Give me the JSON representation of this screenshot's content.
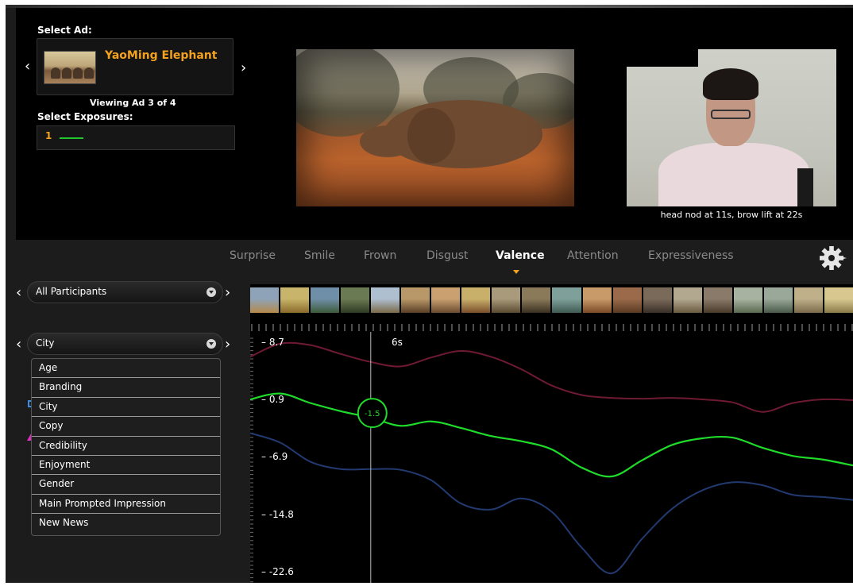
{
  "ad_selector": {
    "label": "Select Ad:",
    "ad_title": "YaoMing Elephant",
    "viewing_text": "Viewing Ad 3 of 4"
  },
  "exposures": {
    "label": "Select Exposures:",
    "items": [
      {
        "number": "1",
        "color": "#1fc82d"
      }
    ]
  },
  "camera": {
    "caption": "head nod at 11s, brow lift at 22s"
  },
  "tabs": [
    {
      "label": "Surprise",
      "active": false
    },
    {
      "label": "Smile",
      "active": false
    },
    {
      "label": "Frown",
      "active": false
    },
    {
      "label": "Disgust",
      "active": false
    },
    {
      "label": "Valence",
      "active": true
    },
    {
      "label": "Attention",
      "active": false
    },
    {
      "label": "Expressiveness",
      "active": false
    }
  ],
  "filters": {
    "participants_value": "All Participants",
    "segment_value": "City",
    "dropdown_options": [
      "Age",
      "Branding",
      "City",
      "Copy",
      "Credibility",
      "Enjoyment",
      "Gender",
      "Main Prompted Impression",
      "New News"
    ]
  },
  "icons": {
    "prev": "chevron-left-icon",
    "next": "chevron-right-icon",
    "settings": "gear-icon"
  },
  "colors": {
    "accent": "#f4a21e",
    "background": "#1c1c1c",
    "panel": "#000000"
  },
  "chart_data": {
    "type": "line",
    "xlabel": "",
    "ylabel": "",
    "cursor": {
      "time_label": "6s",
      "value_label": "-1.5"
    },
    "yticks": [
      8.7,
      0.9,
      -6.9,
      -14.8,
      -22.6
    ],
    "ylim": [
      -24.0,
      10.2
    ],
    "x_range": [
      0,
      30
    ],
    "series": [
      {
        "color": "#6e1a33",
        "x": [
          0,
          1.5,
          3,
          4.5,
          6,
          7.5,
          9,
          10.5,
          12,
          13.5,
          15,
          16.5,
          18,
          19.5,
          21,
          22.5,
          24,
          25.5,
          27,
          28.5,
          30
        ],
        "y": [
          6.8,
          8.6,
          8.4,
          7.2,
          6.1,
          5.5,
          6.7,
          7.6,
          6.8,
          5.1,
          2.9,
          1.6,
          1.2,
          1.1,
          1.2,
          1.0,
          0.6,
          -0.7,
          0.5,
          1.0,
          0.9
        ]
      },
      {
        "color": "#1fdc2a",
        "x": [
          0,
          1.5,
          3,
          4.5,
          6,
          7.5,
          9,
          10.5,
          12,
          13.5,
          15,
          16.5,
          18,
          19.5,
          21,
          22.5,
          24,
          25.5,
          27,
          28.5,
          30
        ],
        "y": [
          1.0,
          1.8,
          0.5,
          -0.6,
          -1.5,
          -2.6,
          -2.0,
          -2.9,
          -4.0,
          -4.7,
          -5.8,
          -8.3,
          -9.5,
          -7.3,
          -5.2,
          -4.3,
          -4.2,
          -5.6,
          -6.7,
          -7.2,
          -8.0
        ]
      },
      {
        "color": "#223a70",
        "x": [
          0,
          1.5,
          3,
          4.5,
          6,
          7.5,
          9,
          10.5,
          12,
          13.5,
          15,
          16.5,
          18,
          19.5,
          21,
          22.5,
          24,
          25.5,
          27,
          28.5,
          30
        ],
        "y": [
          -3.6,
          -4.9,
          -7.5,
          -8.5,
          -8.5,
          -8.6,
          -10.0,
          -13.2,
          -14.0,
          -12.5,
          -14.3,
          -19.2,
          -22.7,
          -18.0,
          -13.9,
          -11.4,
          -10.3,
          -10.7,
          -12.0,
          -12.3,
          -12.7
        ]
      }
    ]
  }
}
